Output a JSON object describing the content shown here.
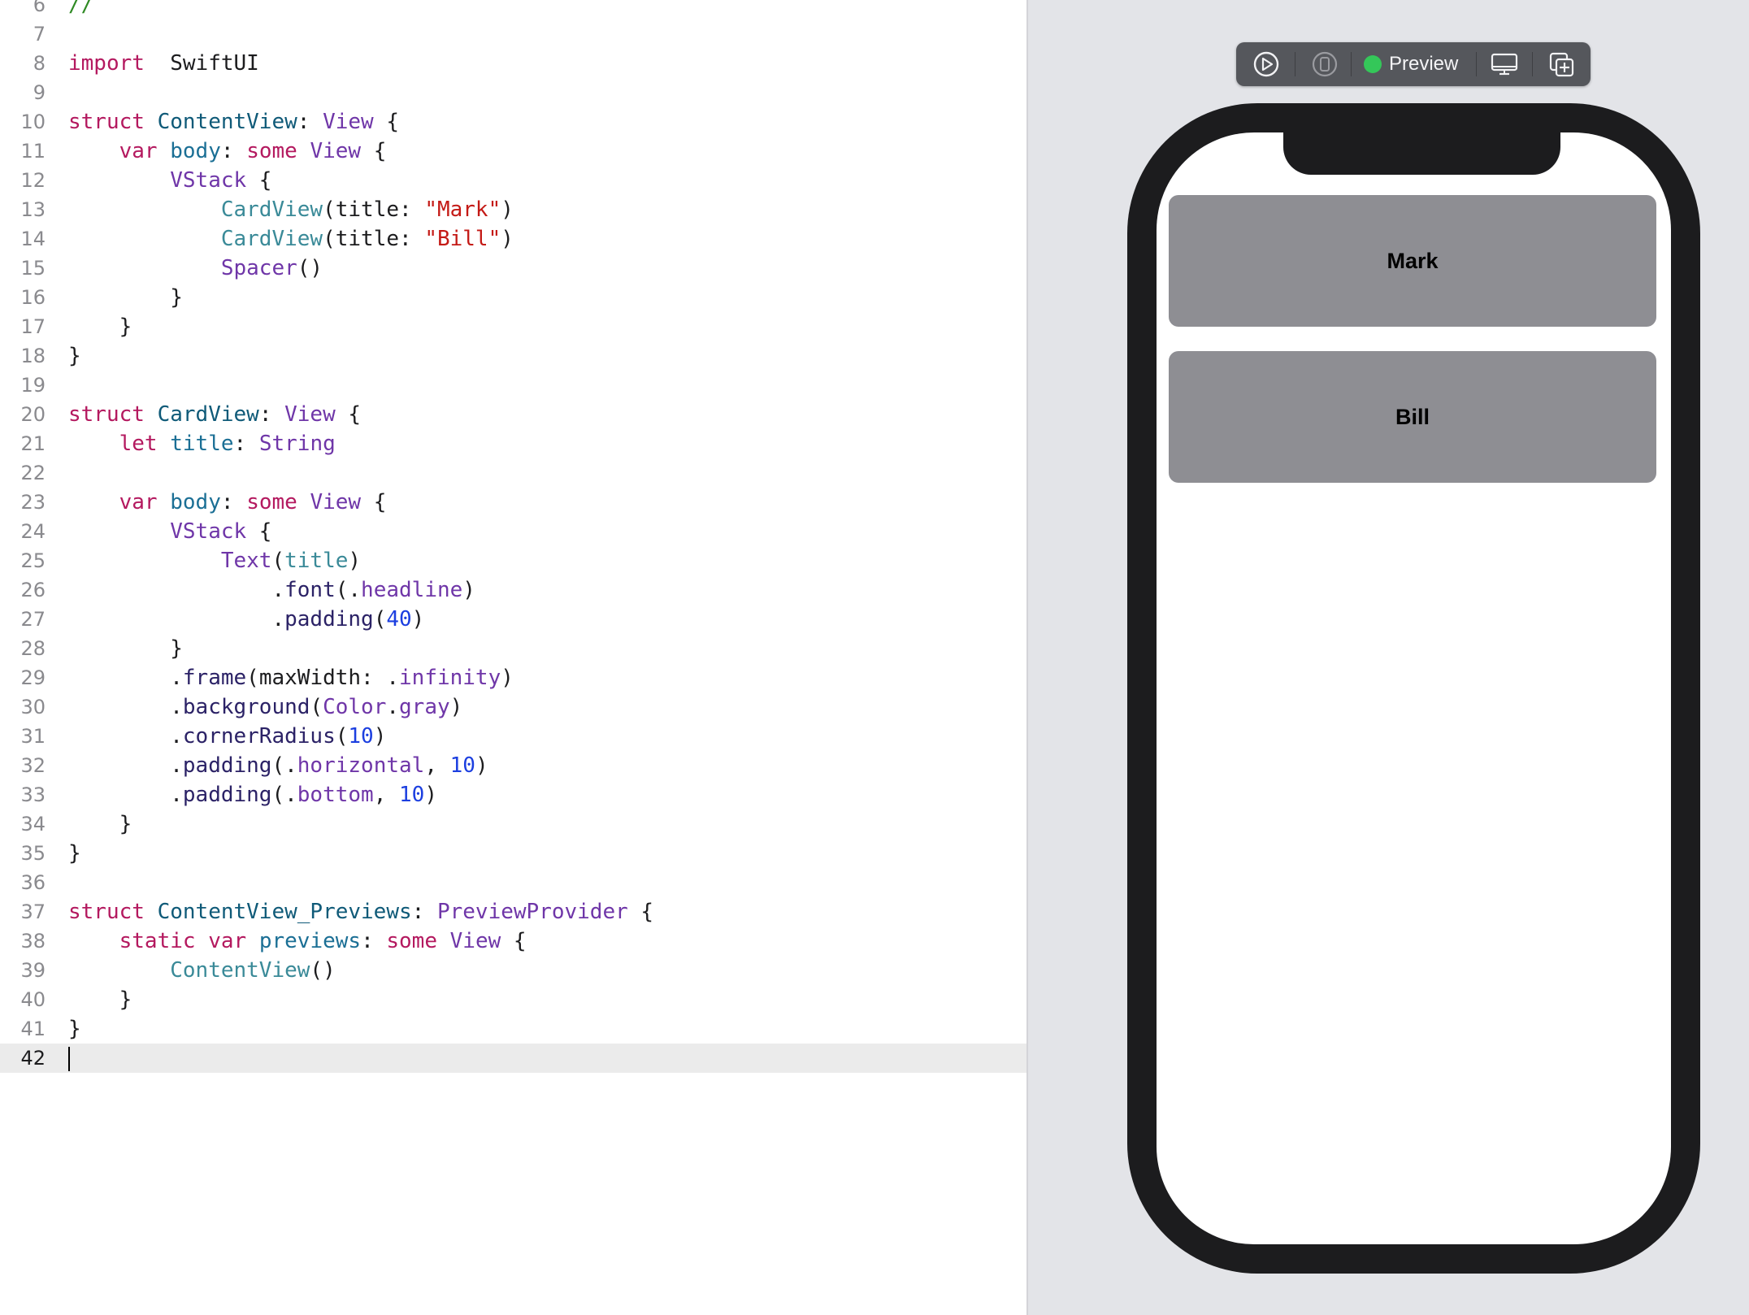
{
  "editor": {
    "lines": [
      {
        "n": "6",
        "segs": [
          [
            "cm",
            "//"
          ]
        ]
      },
      {
        "n": "7",
        "segs": []
      },
      {
        "n": "8",
        "segs": [
          [
            "kw",
            "import"
          ],
          [
            "",
            "  SwiftUI"
          ]
        ]
      },
      {
        "n": "9",
        "segs": []
      },
      {
        "n": "10",
        "segs": [
          [
            "kw",
            "struct"
          ],
          [
            "",
            " "
          ],
          [
            "ty",
            "ContentView"
          ],
          [
            "",
            ": "
          ],
          [
            "lt",
            "View"
          ],
          [
            "",
            " {"
          ]
        ]
      },
      {
        "n": "11",
        "segs": [
          [
            "",
            "    "
          ],
          [
            "kw",
            "var"
          ],
          [
            "",
            " "
          ],
          [
            "pr",
            "body"
          ],
          [
            "",
            ": "
          ],
          [
            "kw",
            "some"
          ],
          [
            "",
            " "
          ],
          [
            "lt",
            "View"
          ],
          [
            "",
            " {"
          ]
        ]
      },
      {
        "n": "12",
        "segs": [
          [
            "",
            "        "
          ],
          [
            "lt",
            "VStack"
          ],
          [
            "",
            " {"
          ]
        ]
      },
      {
        "n": "13",
        "segs": [
          [
            "",
            "            "
          ],
          [
            "ut",
            "CardView"
          ],
          [
            "",
            "(title: "
          ],
          [
            "st",
            "\"Mark\""
          ],
          [
            "",
            ")"
          ]
        ]
      },
      {
        "n": "14",
        "segs": [
          [
            "",
            "            "
          ],
          [
            "ut",
            "CardView"
          ],
          [
            "",
            "(title: "
          ],
          [
            "st",
            "\"Bill\""
          ],
          [
            "",
            ")"
          ]
        ]
      },
      {
        "n": "15",
        "segs": [
          [
            "",
            "            "
          ],
          [
            "lt",
            "Spacer"
          ],
          [
            "",
            "()"
          ]
        ]
      },
      {
        "n": "16",
        "segs": [
          [
            "",
            "        }"
          ]
        ]
      },
      {
        "n": "17",
        "segs": [
          [
            "",
            "    }"
          ]
        ]
      },
      {
        "n": "18",
        "segs": [
          [
            "",
            "}"
          ]
        ]
      },
      {
        "n": "19",
        "segs": []
      },
      {
        "n": "20",
        "segs": [
          [
            "kw",
            "struct"
          ],
          [
            "",
            " "
          ],
          [
            "ty",
            "CardView"
          ],
          [
            "",
            ": "
          ],
          [
            "lt",
            "View"
          ],
          [
            "",
            " {"
          ]
        ]
      },
      {
        "n": "21",
        "segs": [
          [
            "",
            "    "
          ],
          [
            "kw",
            "let"
          ],
          [
            "",
            " "
          ],
          [
            "pr",
            "title"
          ],
          [
            "",
            ": "
          ],
          [
            "lt",
            "String"
          ]
        ]
      },
      {
        "n": "22",
        "segs": []
      },
      {
        "n": "23",
        "segs": [
          [
            "",
            "    "
          ],
          [
            "kw",
            "var"
          ],
          [
            "",
            " "
          ],
          [
            "pr",
            "body"
          ],
          [
            "",
            ": "
          ],
          [
            "kw",
            "some"
          ],
          [
            "",
            " "
          ],
          [
            "lt",
            "View"
          ],
          [
            "",
            " {"
          ]
        ]
      },
      {
        "n": "24",
        "segs": [
          [
            "",
            "        "
          ],
          [
            "lt",
            "VStack"
          ],
          [
            "",
            " {"
          ]
        ]
      },
      {
        "n": "25",
        "segs": [
          [
            "",
            "            "
          ],
          [
            "lt",
            "Text"
          ],
          [
            "",
            "("
          ],
          [
            "ut",
            "title"
          ],
          [
            "",
            ")"
          ]
        ]
      },
      {
        "n": "26",
        "segs": [
          [
            "",
            "                ."
          ],
          [
            "fn",
            "font"
          ],
          [
            "",
            "(."
          ],
          [
            "lt",
            "headline"
          ],
          [
            "",
            ")"
          ]
        ]
      },
      {
        "n": "27",
        "segs": [
          [
            "",
            "                ."
          ],
          [
            "fn",
            "padding"
          ],
          [
            "",
            "("
          ],
          [
            "nm",
            "40"
          ],
          [
            "",
            ")"
          ]
        ]
      },
      {
        "n": "28",
        "segs": [
          [
            "",
            "        }"
          ]
        ]
      },
      {
        "n": "29",
        "segs": [
          [
            "",
            "        ."
          ],
          [
            "fn",
            "frame"
          ],
          [
            "",
            "(maxWidth: ."
          ],
          [
            "lt",
            "infinity"
          ],
          [
            "",
            ")"
          ]
        ]
      },
      {
        "n": "30",
        "segs": [
          [
            "",
            "        ."
          ],
          [
            "fn",
            "background"
          ],
          [
            "",
            "("
          ],
          [
            "lt",
            "Color"
          ],
          [
            "",
            "."
          ],
          [
            "lt",
            "gray"
          ],
          [
            "",
            ")"
          ]
        ]
      },
      {
        "n": "31",
        "segs": [
          [
            "",
            "        ."
          ],
          [
            "fn",
            "cornerRadius"
          ],
          [
            "",
            "("
          ],
          [
            "nm",
            "10"
          ],
          [
            "",
            ")"
          ]
        ]
      },
      {
        "n": "32",
        "segs": [
          [
            "",
            "        ."
          ],
          [
            "fn",
            "padding"
          ],
          [
            "",
            "(."
          ],
          [
            "lt",
            "horizontal"
          ],
          [
            "",
            ", "
          ],
          [
            "nm",
            "10"
          ],
          [
            "",
            ")"
          ]
        ]
      },
      {
        "n": "33",
        "segs": [
          [
            "",
            "        ."
          ],
          [
            "fn",
            "padding"
          ],
          [
            "",
            "(."
          ],
          [
            "lt",
            "bottom"
          ],
          [
            "",
            ", "
          ],
          [
            "nm",
            "10"
          ],
          [
            "",
            ")"
          ]
        ]
      },
      {
        "n": "34",
        "segs": [
          [
            "",
            "    }"
          ]
        ]
      },
      {
        "n": "35",
        "segs": [
          [
            "",
            "}"
          ]
        ]
      },
      {
        "n": "36",
        "segs": []
      },
      {
        "n": "37",
        "segs": [
          [
            "kw",
            "struct"
          ],
          [
            "",
            " "
          ],
          [
            "ty",
            "ContentView_Previews"
          ],
          [
            "",
            ": "
          ],
          [
            "lt",
            "PreviewProvider"
          ],
          [
            "",
            " {"
          ]
        ]
      },
      {
        "n": "38",
        "segs": [
          [
            "",
            "    "
          ],
          [
            "kw",
            "static"
          ],
          [
            "",
            " "
          ],
          [
            "kw",
            "var"
          ],
          [
            "",
            " "
          ],
          [
            "pr",
            "previews"
          ],
          [
            "",
            ": "
          ],
          [
            "kw",
            "some"
          ],
          [
            "",
            " "
          ],
          [
            "lt",
            "View"
          ],
          [
            "",
            " {"
          ]
        ]
      },
      {
        "n": "39",
        "segs": [
          [
            "",
            "        "
          ],
          [
            "ut",
            "ContentView"
          ],
          [
            "",
            "()"
          ]
        ]
      },
      {
        "n": "40",
        "segs": [
          [
            "",
            "    }"
          ]
        ]
      },
      {
        "n": "41",
        "segs": [
          [
            "",
            "}"
          ]
        ]
      },
      {
        "n": "42",
        "segs": [],
        "current": true
      }
    ]
  },
  "toolbar": {
    "live_icon": "play-circle-icon",
    "device_icon": "device-icon",
    "preview_label": "Preview",
    "status_color": "#34c759",
    "inspect_icon": "display-icon",
    "duplicate_icon": "duplicate-icon"
  },
  "preview": {
    "cards": [
      {
        "title": "Mark"
      },
      {
        "title": "Bill"
      }
    ],
    "card_color": "#8e8e93"
  }
}
